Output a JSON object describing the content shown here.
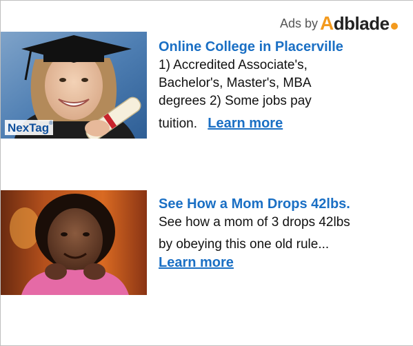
{
  "header": {
    "ads_by_label": "Ads by",
    "logo_a": "A",
    "logo_rest": "dblade"
  },
  "ads": [
    {
      "title": "Online College in Placerville",
      "body_lines": [
        "1) Accredited Associate's,",
        "Bachelor's, Master's, MBA",
        "degrees 2) Some jobs pay",
        "tuition."
      ],
      "cta": "Learn more",
      "image_badge": "NexTag",
      "image_badge_mark": "®"
    },
    {
      "title": "See How a Mom Drops 42lbs.",
      "body_lines": [
        "See how a mom of 3 drops 42lbs",
        "by obeying this one old rule..."
      ],
      "cta": "Learn more"
    }
  ],
  "colors": {
    "link": "#1a6fc4",
    "brand_orange": "#f39a1e",
    "border": "#bfbfbf"
  }
}
